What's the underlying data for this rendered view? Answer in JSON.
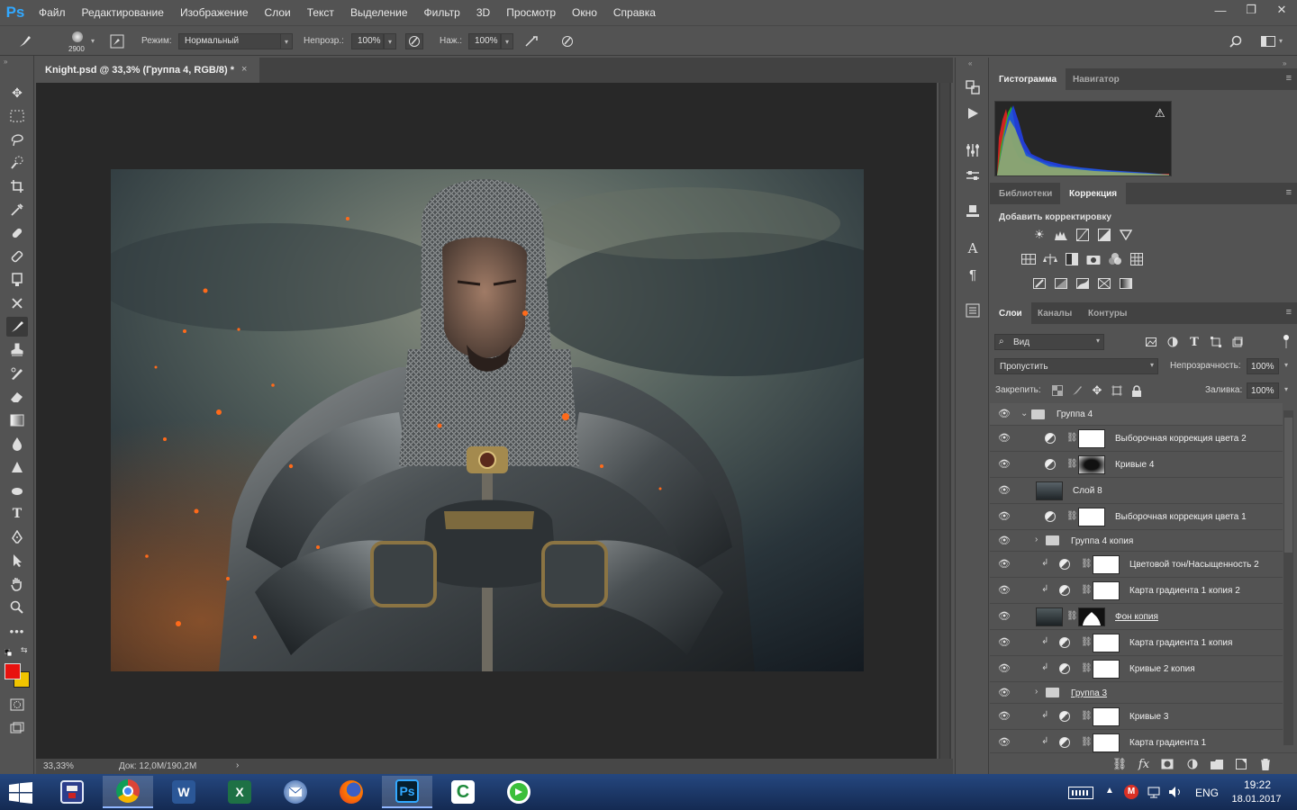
{
  "app": {
    "logo": "Ps",
    "menu": [
      "Файл",
      "Редактирование",
      "Изображение",
      "Слои",
      "Текст",
      "Выделение",
      "Фильтр",
      "3D",
      "Просмотр",
      "Окно",
      "Справка"
    ],
    "window_controls": [
      "—",
      "❐",
      "✕"
    ]
  },
  "options_bar": {
    "brush_size": "2900",
    "mode_label": "Режим:",
    "mode_value": "Нормальный",
    "opacity_label": "Непрозр.:",
    "opacity_value": "100%",
    "flow_label": "Наж.:",
    "flow_value": "100%"
  },
  "document": {
    "tab_title": "Knight.psd @ 33,3% (Группа 4, RGB/8) *",
    "close": "×",
    "zoom": "33,33%",
    "doc_info": "Док: 12,0M/190,2M",
    "status_arrow": "›"
  },
  "top_panel": {
    "tabs": [
      "Гистограмма",
      "Навигатор"
    ],
    "active_tab": 0,
    "warning_icon": "⚠"
  },
  "adjustments_panel": {
    "tabs": [
      "Библиотеки",
      "Коррекция"
    ],
    "active_tab": 1,
    "heading": "Добавить корректировку"
  },
  "layers_panel": {
    "tabs": [
      "Слои",
      "Каналы",
      "Контуры"
    ],
    "active_tab": 0,
    "filter_label": "Вид",
    "blend_mode": "Пропустить",
    "opacity_label": "Непрозрачность:",
    "opacity_value": "100%",
    "lock_label": "Закрепить:",
    "fill_label": "Заливка:",
    "fill_value": "100%",
    "layers": [
      {
        "name": "Группа 4",
        "kind": "group",
        "indent": 0,
        "expanded": true,
        "selected": true
      },
      {
        "name": "Выборочная коррекция цвета 2",
        "kind": "adjustment",
        "indent": 1,
        "mask": "white"
      },
      {
        "name": "Кривые 4",
        "kind": "adjustment",
        "indent": 1,
        "mask": "vignette"
      },
      {
        "name": "Слой 8",
        "kind": "pixel",
        "indent": 1
      },
      {
        "name": "Выборочная коррекция цвета 1",
        "kind": "adjustment",
        "indent": 1,
        "mask": "white"
      },
      {
        "name": "Группа 4 копия",
        "kind": "group",
        "indent": 1,
        "expanded": false
      },
      {
        "name": "Цветовой тон/Насыщенность 2",
        "kind": "adjustment",
        "indent": 2,
        "clipped": true,
        "mask": "white"
      },
      {
        "name": "Карта градиента 1 копия 2",
        "kind": "adjustment",
        "indent": 2,
        "clipped": true,
        "mask": "white"
      },
      {
        "name": "Фон копия",
        "kind": "pixel-masked",
        "indent": 2,
        "underline": true
      },
      {
        "name": "Карта градиента 1 копия",
        "kind": "adjustment",
        "indent": 2,
        "clipped": true,
        "mask": "white"
      },
      {
        "name": "Кривые 2 копия",
        "kind": "adjustment",
        "indent": 2,
        "clipped": true,
        "mask": "white"
      },
      {
        "name": "Группа 3",
        "kind": "group",
        "indent": 1,
        "expanded": false,
        "underline": true
      },
      {
        "name": "Кривые 3",
        "kind": "adjustment",
        "indent": 2,
        "clipped": true,
        "mask": "white"
      },
      {
        "name": "Карта градиента 1",
        "kind": "adjustment",
        "indent": 2,
        "clipped": true,
        "mask": "white"
      }
    ]
  },
  "taskbar": {
    "apps": [
      "save-app",
      "chrome",
      "word",
      "excel",
      "thunderbird",
      "firefox",
      "photoshop",
      "camtasia",
      "green-app"
    ],
    "active_app": "photoshop",
    "ps_label": "Ps",
    "word_label": "W",
    "excel_label": "X",
    "camtasia_label": "C",
    "language": "ENG",
    "time": "19:22",
    "date": "18.01.2017"
  },
  "colors": {
    "foreground": "#e8120f",
    "background": "#f0c400",
    "accent": "#31a8ff"
  }
}
